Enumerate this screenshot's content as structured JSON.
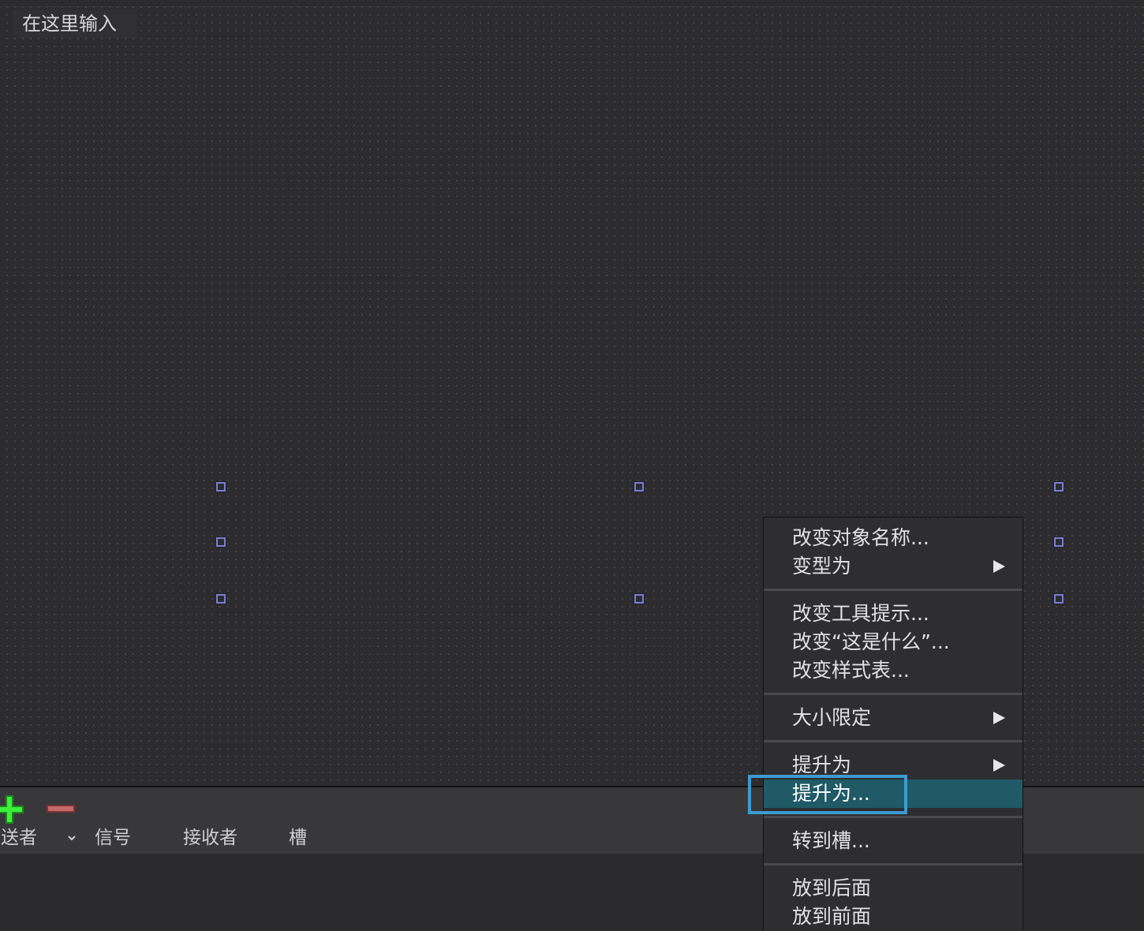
{
  "canvas": {
    "menubar_placeholder": "在这里输入"
  },
  "signal_slot_editor": {
    "add_icon": "plus-icon",
    "remove_icon": "minus-icon",
    "columns": [
      "发送者",
      "信号",
      "接收者",
      "槽"
    ],
    "sort_icon": "chevron-down-icon"
  },
  "context_menu": {
    "items": [
      {
        "label": "改变对象名称...",
        "submenu": false
      },
      {
        "label": "变型为",
        "submenu": true
      },
      {
        "label": "改变工具提示...",
        "submenu": false
      },
      {
        "label": "改变“这是什么”...",
        "submenu": false
      },
      {
        "label": "改变样式表...",
        "submenu": false
      },
      {
        "label": "大小限定",
        "submenu": true
      },
      {
        "label": "提升为",
        "submenu": true
      },
      {
        "label": "提升为...",
        "submenu": false,
        "highlighted": true
      },
      {
        "label": "转到槽...",
        "submenu": false
      },
      {
        "label": "放到后面",
        "submenu": false
      },
      {
        "label": "放到前面",
        "submenu": false
      }
    ]
  },
  "colors": {
    "background": "#2c2c2f",
    "highlight": "#1f5a66",
    "focus_outline": "#3c9bcf",
    "handle": "#7b7dd8",
    "add_green": "#22cc22",
    "remove_red": "#b05050"
  }
}
